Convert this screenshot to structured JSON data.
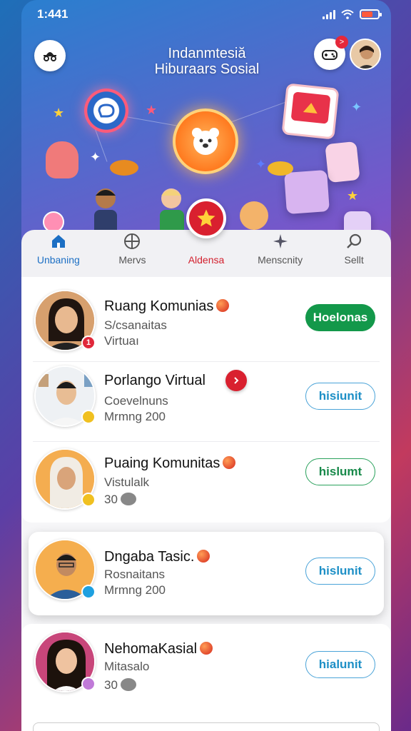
{
  "status_bar": {
    "time": "1:441"
  },
  "header": {
    "title_line1": "Indanmtesiă",
    "title_line2": "Hiburaars Sosial",
    "notif_count": ">"
  },
  "nav": {
    "items": [
      {
        "label": "Unbaning",
        "icon": "home-icon"
      },
      {
        "label": "Mervs",
        "icon": "grid-icon"
      },
      {
        "label": "Aldensa",
        "icon": "star-icon"
      },
      {
        "label": "Menscnity",
        "icon": "star-burst-icon"
      },
      {
        "label": "Sellt",
        "icon": "search-icon"
      }
    ]
  },
  "rows": [
    {
      "title": "Ruang Komunias",
      "sub1": "S/csanaitas",
      "sub2": "Virtuaı",
      "badge": "1",
      "action": "Hoelonas"
    },
    {
      "title": "Porlango Virtual",
      "sub1": "Coevelnuns",
      "sub2": "Mrmng 200",
      "badge": "",
      "action": "hisiunit"
    },
    {
      "title": "Puaing Komunitas",
      "sub1": "Vistulalk",
      "sub2": "30",
      "badge": "",
      "action": "hislumt"
    },
    {
      "title": "Dngaba Tasic.",
      "sub1": "Rosnaitans",
      "sub2": "Mrmng 200",
      "badge": "",
      "action": "hislunit"
    },
    {
      "title": "NehomaKasial",
      "sub1": "Mitasalo",
      "sub2": "30",
      "badge": "",
      "action": "hialunit"
    }
  ],
  "colors": {
    "accent_red": "#d9202f",
    "accent_blue": "#1c6fc4",
    "accent_green": "#13984a"
  }
}
